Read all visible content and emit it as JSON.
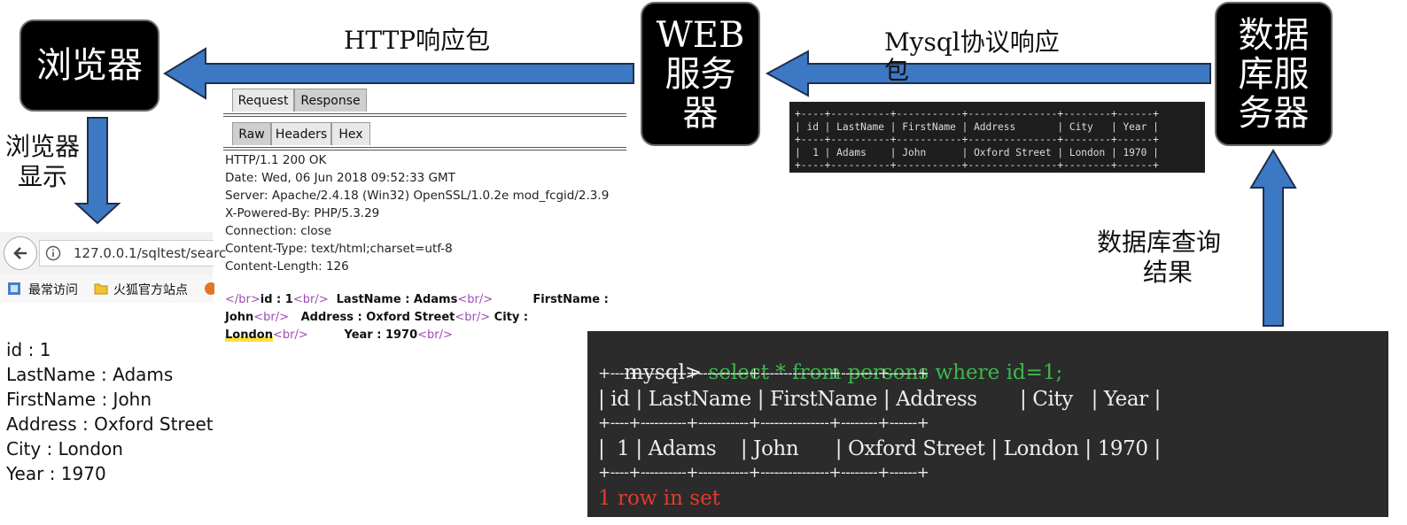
{
  "nodes": {
    "browser": "浏览器",
    "web_server": [
      "WEB",
      "服务",
      "器"
    ],
    "db_server": [
      "数据",
      "库服",
      "务器"
    ]
  },
  "labels": {
    "http_response": "HTTP响应包",
    "mysql_response": [
      "Mysql协议响应",
      "包"
    ],
    "browser_display": [
      "浏览器",
      "显示"
    ],
    "db_query_result": [
      "数据库查询",
      "结果"
    ]
  },
  "burp": {
    "tabs_top": [
      "Request",
      "Response"
    ],
    "tabs_sub": [
      "Raw",
      "Headers",
      "Hex"
    ],
    "headers": [
      "HTTP/1.1 200 OK",
      "Date: Wed, 06 Jun 2018 09:52:33 GMT",
      "Server: Apache/2.4.18 (Win32) OpenSSL/1.0.2e mod_fcgid/2.3.9",
      "X-Powered-By: PHP/5.3.29",
      "Connection: close",
      "Content-Type: text/html;charset=utf-8",
      "Content-Length: 126"
    ],
    "body_line1": {
      "t1": "</br>",
      "t2": "id : 1",
      "t3": "<br/>",
      "t4": "  LastName : Adams",
      "t5": "<br/>",
      "t6": "          FirstName :"
    },
    "body_line2": {
      "t1": "John",
      "t2": "<br/>",
      "t3": "   Address : Oxford Street",
      "t4": "<br/>",
      "t5": " City :"
    },
    "body_line3": {
      "t1": "London",
      "t2": "<br/>",
      "t3": "         Year : 1970",
      "t4": "<br/>"
    }
  },
  "browser_window": {
    "url": "127.0.0.1/sqltest/searc",
    "bookmarks": [
      "最常访问",
      "火狐官方站点"
    ]
  },
  "result_lines": [
    "id : 1",
    "LastName : Adams",
    "FirstName : John",
    "Address : Oxford Street",
    "City : London",
    "Year : 1970"
  ],
  "small_terminal": [
    "+----+----------+-----------+---------------+--------+------+",
    "| id | LastName | FirstName | Address       | City   | Year |",
    "+----+----------+-----------+---------------+--------+------+",
    "|  1 | Adams    | John      | Oxford Street | London | 1970 |",
    "+----+----------+-----------+---------------+--------+------+"
  ],
  "big_terminal": {
    "prompt": "mysql>",
    "command": " select * from persons where id=1;",
    "border": "+----+----------+-----------+---------------+--------+------+",
    "header_row": "| id | LastName | FirstName | Address       | City   | Year |",
    "data_row": "|  1 | Adams    | John      | Oxford Street | London | 1970 |",
    "footer": "1 row in set"
  },
  "colors": {
    "arrow_fill": "#3d78c4",
    "arrow_stroke": "#1f2f4a",
    "node_bg": "#000000",
    "terminal_green": "#3db84a",
    "terminal_red": "#e23a2e",
    "tag_purple": "#a04bb5"
  }
}
